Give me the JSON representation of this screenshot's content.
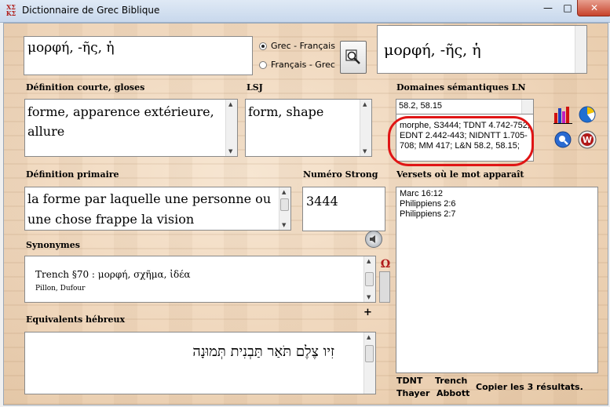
{
  "window": {
    "title": "Dictionnaire de Grec Biblique",
    "icon_glyph": "ΧΣ ΚΣ",
    "minimize": "—",
    "maximize": "□",
    "close": "✕"
  },
  "search": {
    "value": "μορφή, -ῆς, ἡ",
    "direction_options": [
      "Grec - Français",
      "Français - Grec"
    ],
    "selected_direction": "Grec - Français"
  },
  "headword": "μορφή, -ῆς, ἡ",
  "short_definition": {
    "label": "Définition courte, gloses",
    "value": "forme, apparence extérieure, allure"
  },
  "lsj": {
    "label": "LSJ",
    "value": "form, shape"
  },
  "semantic_domains": {
    "label": "Domaines sémantiques LN",
    "value": "58.2,  58.15",
    "references": "morphe, S3444; TDNT 4.742-752; EDNT 2.442-443; NIDNTT 1.705-708; MM 417; L&N 58.2, 58.15;"
  },
  "primary_definition": {
    "label": "Définition primaire",
    "value": "la forme par laquelle une personne ou une chose frappe la vision"
  },
  "strong": {
    "label": "Numéro Strong",
    "value": "3444"
  },
  "verses": {
    "label": "Versets où le mot apparaît",
    "items": [
      "Marc 16:12",
      "Philippiens 2:6",
      "Philippiens 2:7"
    ]
  },
  "synonyms": {
    "label": "Synonymes",
    "line1": "Trench §70 : μορφή, σχῆμα, ἰδέα",
    "line2": "Pillon, Dufour"
  },
  "hebrew": {
    "label": "Equivalents hébreux",
    "value": "זִיו צֶלֶם תֹּאַר תַּבְנִית תְּמוּנָה",
    "add_symbol": "+"
  },
  "footer": {
    "tdnt": "TDNT",
    "trench": "Trench",
    "thayer": "Thayer",
    "abbott": "Abbott",
    "copy": "Copier les 3 résultats."
  },
  "colors": {
    "highlight_ring": "#e01515",
    "parchment": "#efd6bb"
  }
}
